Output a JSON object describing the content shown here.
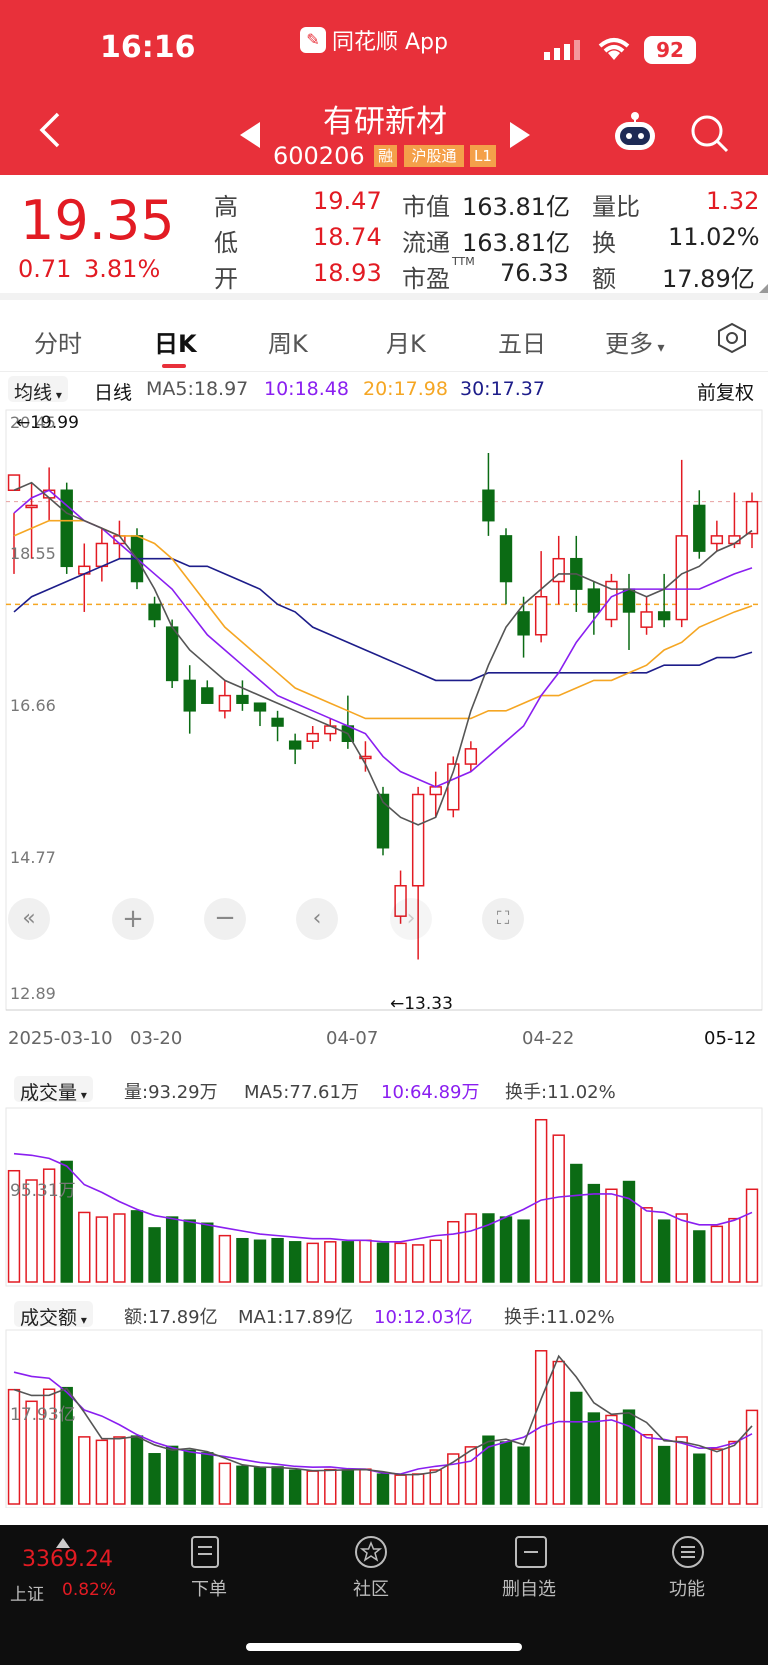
{
  "status_bar": {
    "time": "16:16",
    "app_label": "同花顺 App",
    "battery": "92"
  },
  "header": {
    "stock_name": "有研新材",
    "stock_code": "600206",
    "badges": [
      "融",
      "沪股通",
      "L1"
    ]
  },
  "quote": {
    "price": "19.35",
    "change": "0.71",
    "change_pct": "3.81%",
    "high_label": "高",
    "high": "19.47",
    "low_label": "低",
    "low": "18.74",
    "open_label": "开",
    "open": "18.93",
    "mktcap_label": "市值",
    "mktcap": "163.81亿",
    "float_label": "流通",
    "float": "163.81亿",
    "pe_label": "市盈",
    "pe_sup": "TTM",
    "pe": "76.33",
    "volratio_label": "量比",
    "volratio": "1.32",
    "turnover_label": "换",
    "turnover": "11.02%",
    "amount_label": "额",
    "amount": "17.89亿"
  },
  "tabs": [
    "分时",
    "日K",
    "周K",
    "月K",
    "五日",
    "更多"
  ],
  "active_tab": 1,
  "ma_legend": {
    "selector": "均线",
    "period": "日线",
    "ma5": "MA5:18.97",
    "ma10": "10:18.48",
    "ma20": "20:17.98",
    "ma30": "30:17.37",
    "adjust": "前复权"
  },
  "colors": {
    "up": "#e21b23",
    "down": "#0b6b14",
    "ma5": "#555555",
    "ma10": "#8a1ff0",
    "ma20": "#f5a623",
    "ma30": "#1d1d8a",
    "accent": "#e8303a"
  },
  "price_axis": {
    "ticks": [
      "20.45",
      "18.55",
      "16.66",
      "14.77",
      "12.89"
    ],
    "high_marker": "←19.99",
    "low_marker": "←13.33"
  },
  "date_axis": [
    "2025-03-10",
    "03-20",
    "04-07",
    "04-22",
    "05-12"
  ],
  "volume_panel": {
    "selector": "成交量",
    "vol": "量:93.29万",
    "ma5": "MA5:77.61万",
    "ma10": "10:64.89万",
    "turnover": "换手:11.02%",
    "axis_label": "95.31万"
  },
  "amount_panel": {
    "selector": "成交额",
    "amt": "额:17.89亿",
    "ma1": "MA1:17.89亿",
    "ma10": "10:12.03亿",
    "turnover": "换手:11.02%",
    "axis_label": "17.93亿"
  },
  "bottom_nav": {
    "index_value": "3369.24",
    "index_name": "上证",
    "index_pct": "0.82%",
    "items": [
      "下单",
      "社区",
      "删自选",
      "功能"
    ]
  },
  "chart_data": {
    "type": "candlestick",
    "price_ylim": [
      12.89,
      20.45
    ],
    "candles": [
      [
        19.5,
        19.7,
        19.2,
        18.4
      ],
      [
        19.3,
        19.3,
        19.6,
        18.6
      ],
      [
        19.4,
        19.5,
        19.8,
        19.1
      ],
      [
        19.5,
        18.5,
        19.6,
        18.4
      ],
      [
        18.4,
        18.5,
        18.8,
        17.9
      ],
      [
        18.5,
        18.8,
        19.0,
        18.3
      ],
      [
        18.8,
        18.9,
        19.1,
        18.6
      ],
      [
        18.9,
        18.3,
        19.0,
        18.2
      ],
      [
        18.0,
        17.8,
        18.1,
        17.7
      ],
      [
        17.7,
        17.0,
        17.8,
        16.9
      ],
      [
        17.0,
        16.6,
        17.2,
        16.3
      ],
      [
        16.9,
        16.7,
        17.0,
        16.7
      ],
      [
        16.6,
        16.8,
        17.0,
        16.5
      ],
      [
        16.8,
        16.7,
        17.0,
        16.6
      ],
      [
        16.7,
        16.6,
        16.7,
        16.4
      ],
      [
        16.5,
        16.4,
        16.6,
        16.2
      ],
      [
        16.2,
        16.1,
        16.3,
        15.9
      ],
      [
        16.2,
        16.3,
        16.4,
        16.1
      ],
      [
        16.3,
        16.4,
        16.5,
        16.2
      ],
      [
        16.4,
        16.2,
        16.8,
        16.1
      ],
      [
        16.0,
        16.0,
        16.2,
        15.8
      ],
      [
        15.5,
        14.8,
        15.6,
        14.7
      ],
      [
        13.9,
        14.3,
        14.5,
        13.8
      ],
      [
        14.3,
        15.5,
        15.6,
        13.33
      ],
      [
        15.5,
        15.6,
        15.8,
        15.2
      ],
      [
        15.3,
        15.9,
        16.0,
        15.2
      ],
      [
        15.9,
        16.1,
        16.2,
        15.8
      ],
      [
        19.5,
        19.1,
        19.99,
        18.9
      ],
      [
        18.9,
        18.3,
        19.0,
        18.0
      ],
      [
        17.9,
        17.6,
        18.1,
        17.3
      ],
      [
        17.6,
        18.1,
        18.7,
        17.5
      ],
      [
        18.3,
        18.6,
        18.9,
        18.0
      ],
      [
        18.6,
        18.2,
        18.9,
        17.9
      ],
      [
        18.2,
        17.9,
        18.3,
        17.6
      ],
      [
        17.8,
        18.3,
        18.4,
        17.7
      ],
      [
        18.2,
        17.9,
        18.4,
        17.4
      ],
      [
        17.7,
        17.9,
        18.1,
        17.6
      ],
      [
        17.9,
        17.8,
        18.4,
        17.7
      ],
      [
        17.8,
        18.9,
        19.9,
        17.7
      ],
      [
        19.3,
        18.7,
        19.5,
        18.6
      ],
      [
        18.8,
        18.9,
        19.1,
        18.7
      ],
      [
        18.8,
        18.9,
        19.47,
        18.74
      ],
      [
        18.93,
        19.35,
        19.47,
        18.74
      ]
    ],
    "ma5": [
      19.5,
      19.6,
      19.4,
      19.2,
      19.1,
      19.0,
      18.9,
      18.6,
      18.2,
      17.7,
      17.4,
      17.2,
      17.0,
      16.9,
      16.8,
      16.7,
      16.6,
      16.5,
      16.4,
      16.3,
      15.9,
      15.4,
      15.2,
      15.1,
      15.2,
      15.8,
      16.6,
      17.2,
      17.7,
      18.0,
      18.2,
      18.4,
      18.4,
      18.3,
      18.2,
      18.2,
      18.1,
      18.2,
      18.4,
      18.5,
      18.7,
      18.8,
      18.97
    ],
    "ma10": [
      19.2,
      19.4,
      19.5,
      19.3,
      19.1,
      19.0,
      18.8,
      18.6,
      18.4,
      18.2,
      17.9,
      17.6,
      17.4,
      17.2,
      17.0,
      16.8,
      16.7,
      16.6,
      16.5,
      16.4,
      16.3,
      16.0,
      15.8,
      15.7,
      15.6,
      15.7,
      15.8,
      16.0,
      16.2,
      16.4,
      16.8,
      17.1,
      17.5,
      17.8,
      18.1,
      18.2,
      18.2,
      18.2,
      18.2,
      18.2,
      18.3,
      18.4,
      18.48
    ],
    "ma20": [
      18.9,
      19.0,
      19.1,
      19.1,
      19.1,
      19.0,
      18.9,
      18.9,
      18.8,
      18.6,
      18.3,
      18.0,
      17.7,
      17.5,
      17.3,
      17.1,
      16.9,
      16.8,
      16.7,
      16.6,
      16.5,
      16.5,
      16.5,
      16.5,
      16.5,
      16.5,
      16.5,
      16.6,
      16.6,
      16.7,
      16.8,
      16.8,
      16.9,
      17.0,
      17.0,
      17.1,
      17.2,
      17.4,
      17.5,
      17.7,
      17.8,
      17.9,
      17.98
    ],
    "ma30": [
      17.9,
      18.1,
      18.2,
      18.3,
      18.4,
      18.5,
      18.6,
      18.6,
      18.6,
      18.6,
      18.5,
      18.5,
      18.4,
      18.3,
      18.2,
      18.0,
      17.9,
      17.7,
      17.6,
      17.5,
      17.4,
      17.3,
      17.2,
      17.1,
      17.0,
      17.0,
      17.0,
      17.1,
      17.1,
      17.1,
      17.1,
      17.1,
      17.1,
      17.1,
      17.1,
      17.1,
      17.1,
      17.2,
      17.2,
      17.2,
      17.3,
      17.3,
      17.37
    ],
    "volume": [
      72,
      66,
      73,
      78,
      45,
      42,
      44,
      46,
      35,
      42,
      40,
      38,
      30,
      28,
      27,
      28,
      26,
      25,
      26,
      26,
      27,
      25,
      25,
      24,
      27,
      39,
      44,
      44,
      42,
      40,
      105,
      95,
      76,
      63,
      60,
      65,
      48,
      40,
      44,
      33,
      36,
      41,
      60
    ],
    "volume_ma10": [
      83,
      82,
      80,
      75,
      63,
      58,
      52,
      47,
      43,
      41,
      39,
      37,
      35,
      33,
      31,
      30,
      29,
      28,
      28,
      27,
      27,
      26,
      26,
      28,
      30,
      31,
      33,
      37,
      42,
      47,
      53,
      55,
      56,
      57,
      57,
      54,
      46,
      45,
      40,
      37,
      37,
      40,
      45
    ]
  }
}
